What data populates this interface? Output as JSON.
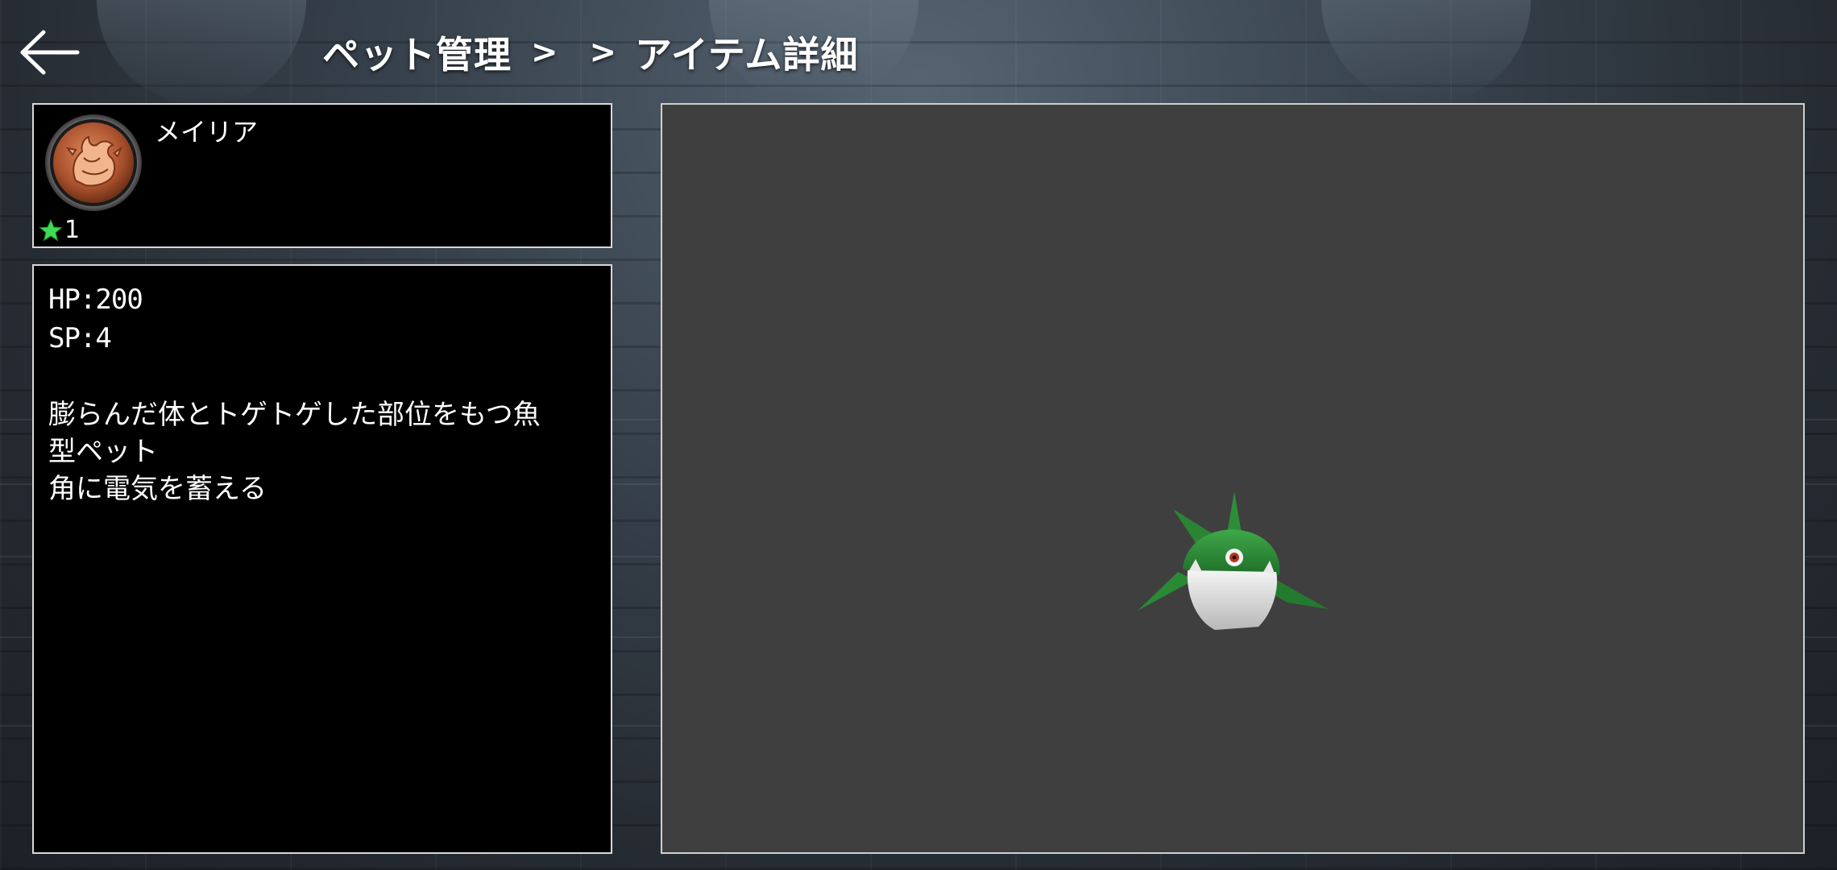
{
  "header": {
    "breadcrumb": [
      {
        "label": "ペット管理",
        "sep": ">"
      },
      {
        "label": "",
        "sep": ">"
      },
      {
        "label": "アイテム詳細"
      }
    ]
  },
  "pet": {
    "name": "メイリア",
    "rank": "1",
    "icon": "pet-emblem-icon",
    "rank_icon": "star-icon"
  },
  "details": {
    "hp": "HP:200",
    "sp": "SP:4",
    "description": [
      "膨らんだ体とトゲトゲした部位をもつ魚",
      "型ペット",
      "角に電気を蓄える"
    ]
  },
  "preview": {
    "model": "green-spiky-fish-pet"
  },
  "colors": {
    "panel_bg": "#000000",
    "panel_border": "#d8d8d8",
    "preview_bg": "#3f3f3f",
    "star": "#3ddc55",
    "emblem": "#c8643a"
  }
}
